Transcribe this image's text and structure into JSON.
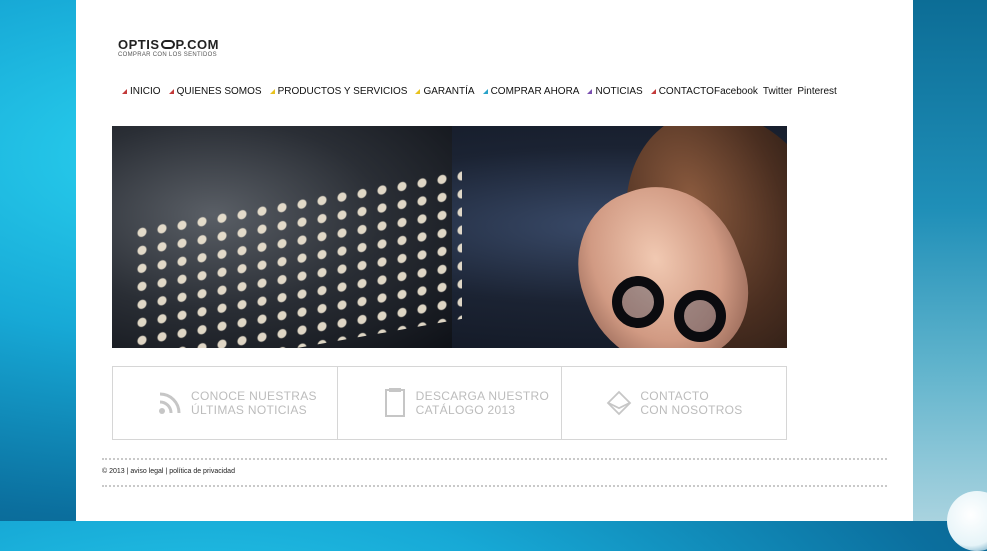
{
  "logo": {
    "brand_prefix": "OPTIS",
    "brand_suffix": "P.COM",
    "tagline": "COMPRAR CON LOS SENTIDOS"
  },
  "nav": [
    {
      "label": "INICIO",
      "color": "#c33a3a"
    },
    {
      "label": "QUIENES SOMOS",
      "color": "#c33a3a"
    },
    {
      "label": "PRODUCTOS Y SERVICIOS",
      "color": "#e8c21e"
    },
    {
      "label": "GARANTÍA",
      "color": "#e8c21e"
    },
    {
      "label": "COMPRAR AHORA",
      "color": "#2aa3c9"
    },
    {
      "label": "NOTICIAS",
      "color": "#7a4fb0"
    },
    {
      "label": "CONTACTO",
      "color": "#c33a3a"
    }
  ],
  "social": [
    "Facebook",
    "Twitter",
    "Pinterest"
  ],
  "boxes": [
    {
      "line1": "CONOCE NUESTRAS",
      "line2": "ÚLTIMAS NOTICIAS",
      "icon": "rss-icon"
    },
    {
      "line1": "DESCARGA NUESTRO",
      "line2": "CATÁLOGO 2013",
      "icon": "document-icon"
    },
    {
      "line1": "CONTACTO",
      "line2": "CON NOSOTROS",
      "icon": "envelope-icon"
    }
  ],
  "footer": {
    "copyright": "© 2013",
    "sep": " | ",
    "legal": "aviso legal",
    "privacy": "política de privacidad"
  }
}
